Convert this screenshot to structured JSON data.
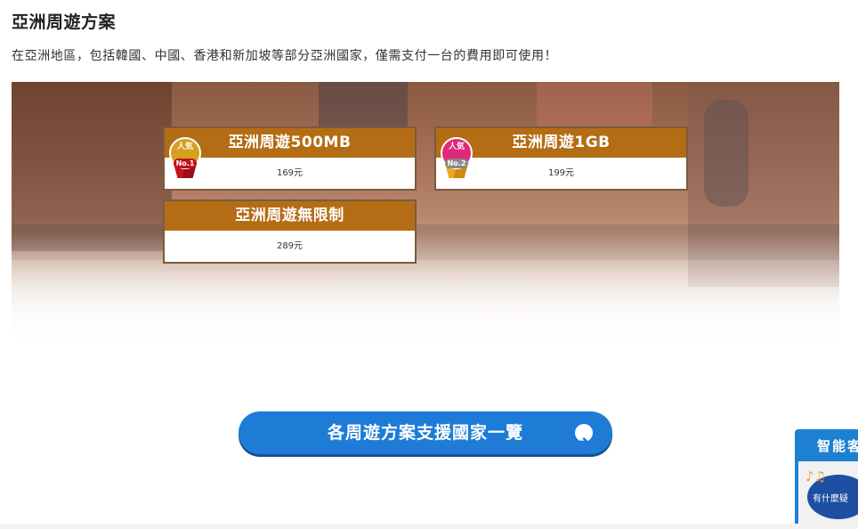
{
  "page": {
    "title": "亞洲周遊方案",
    "description": "在亞洲地區，包括韓國、中國、香港和新加坡等部分亞洲國家，僅需支付一台的費用即可使用！"
  },
  "plans": [
    {
      "name": "亞洲周遊500MB",
      "price": "169元",
      "badge": {
        "text": "人気",
        "rank": "No.1"
      }
    },
    {
      "name": "亞洲周遊1GB",
      "price": "199元",
      "badge": {
        "text": "人気",
        "rank": "No.2"
      }
    },
    {
      "name": "亞洲周遊無限制",
      "price": "289元"
    }
  ],
  "cta": {
    "label": "各周遊方案支援國家一覽",
    "icon": "arrow-right-circle-icon"
  },
  "chat_widget": {
    "title": "智能客",
    "bubble_text": "有什麼疑",
    "icon": "music-notes-icon"
  },
  "colors": {
    "plan_header": "#b46d14",
    "plan_border": "#7a5b3e",
    "cta": "#1e7cd6",
    "chat": "#1e80d0",
    "medal_gold": "#d4a020",
    "medal_red": "#c2121c",
    "medal_pink": "#e0287a",
    "medal_grey": "#8a8a8a"
  }
}
